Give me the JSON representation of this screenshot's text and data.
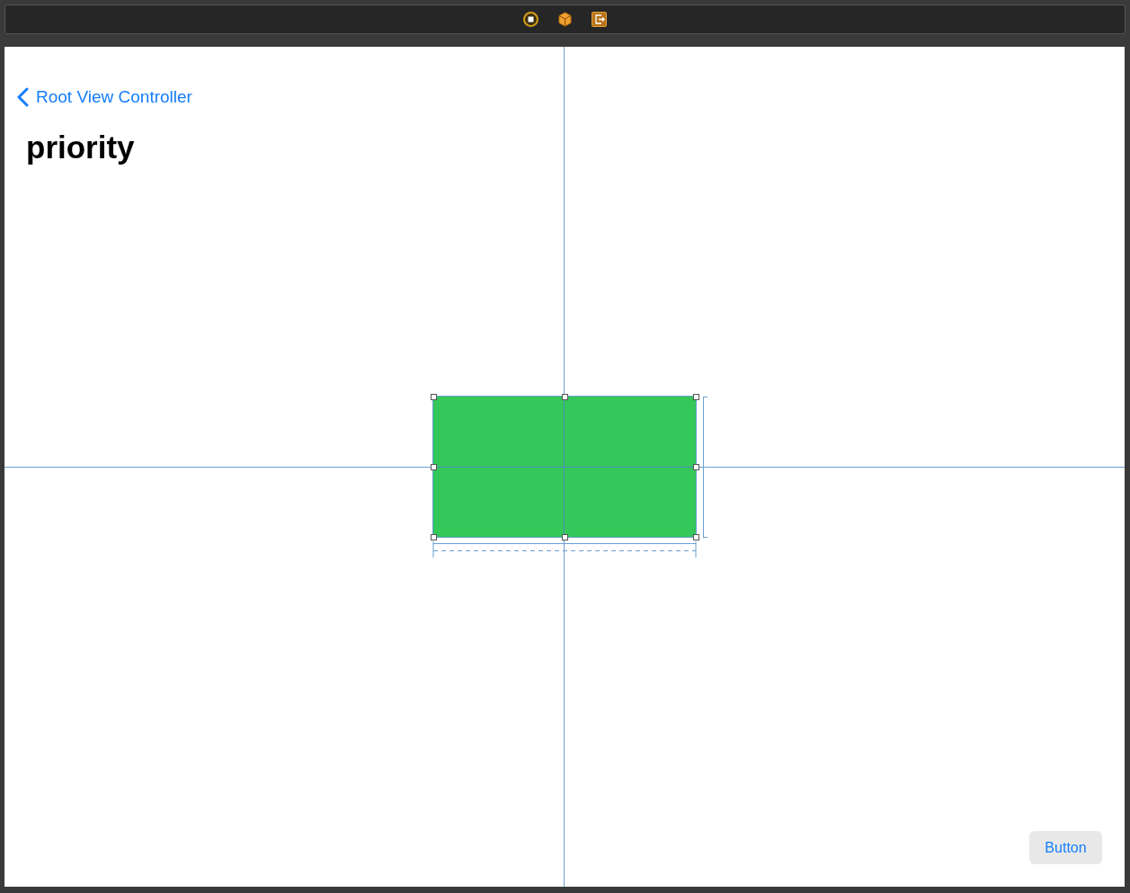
{
  "navigation_bar": {
    "back_label": "Root View Controller",
    "title": "priority"
  },
  "view": {
    "selected": true
  },
  "button": {
    "label": "Button"
  }
}
